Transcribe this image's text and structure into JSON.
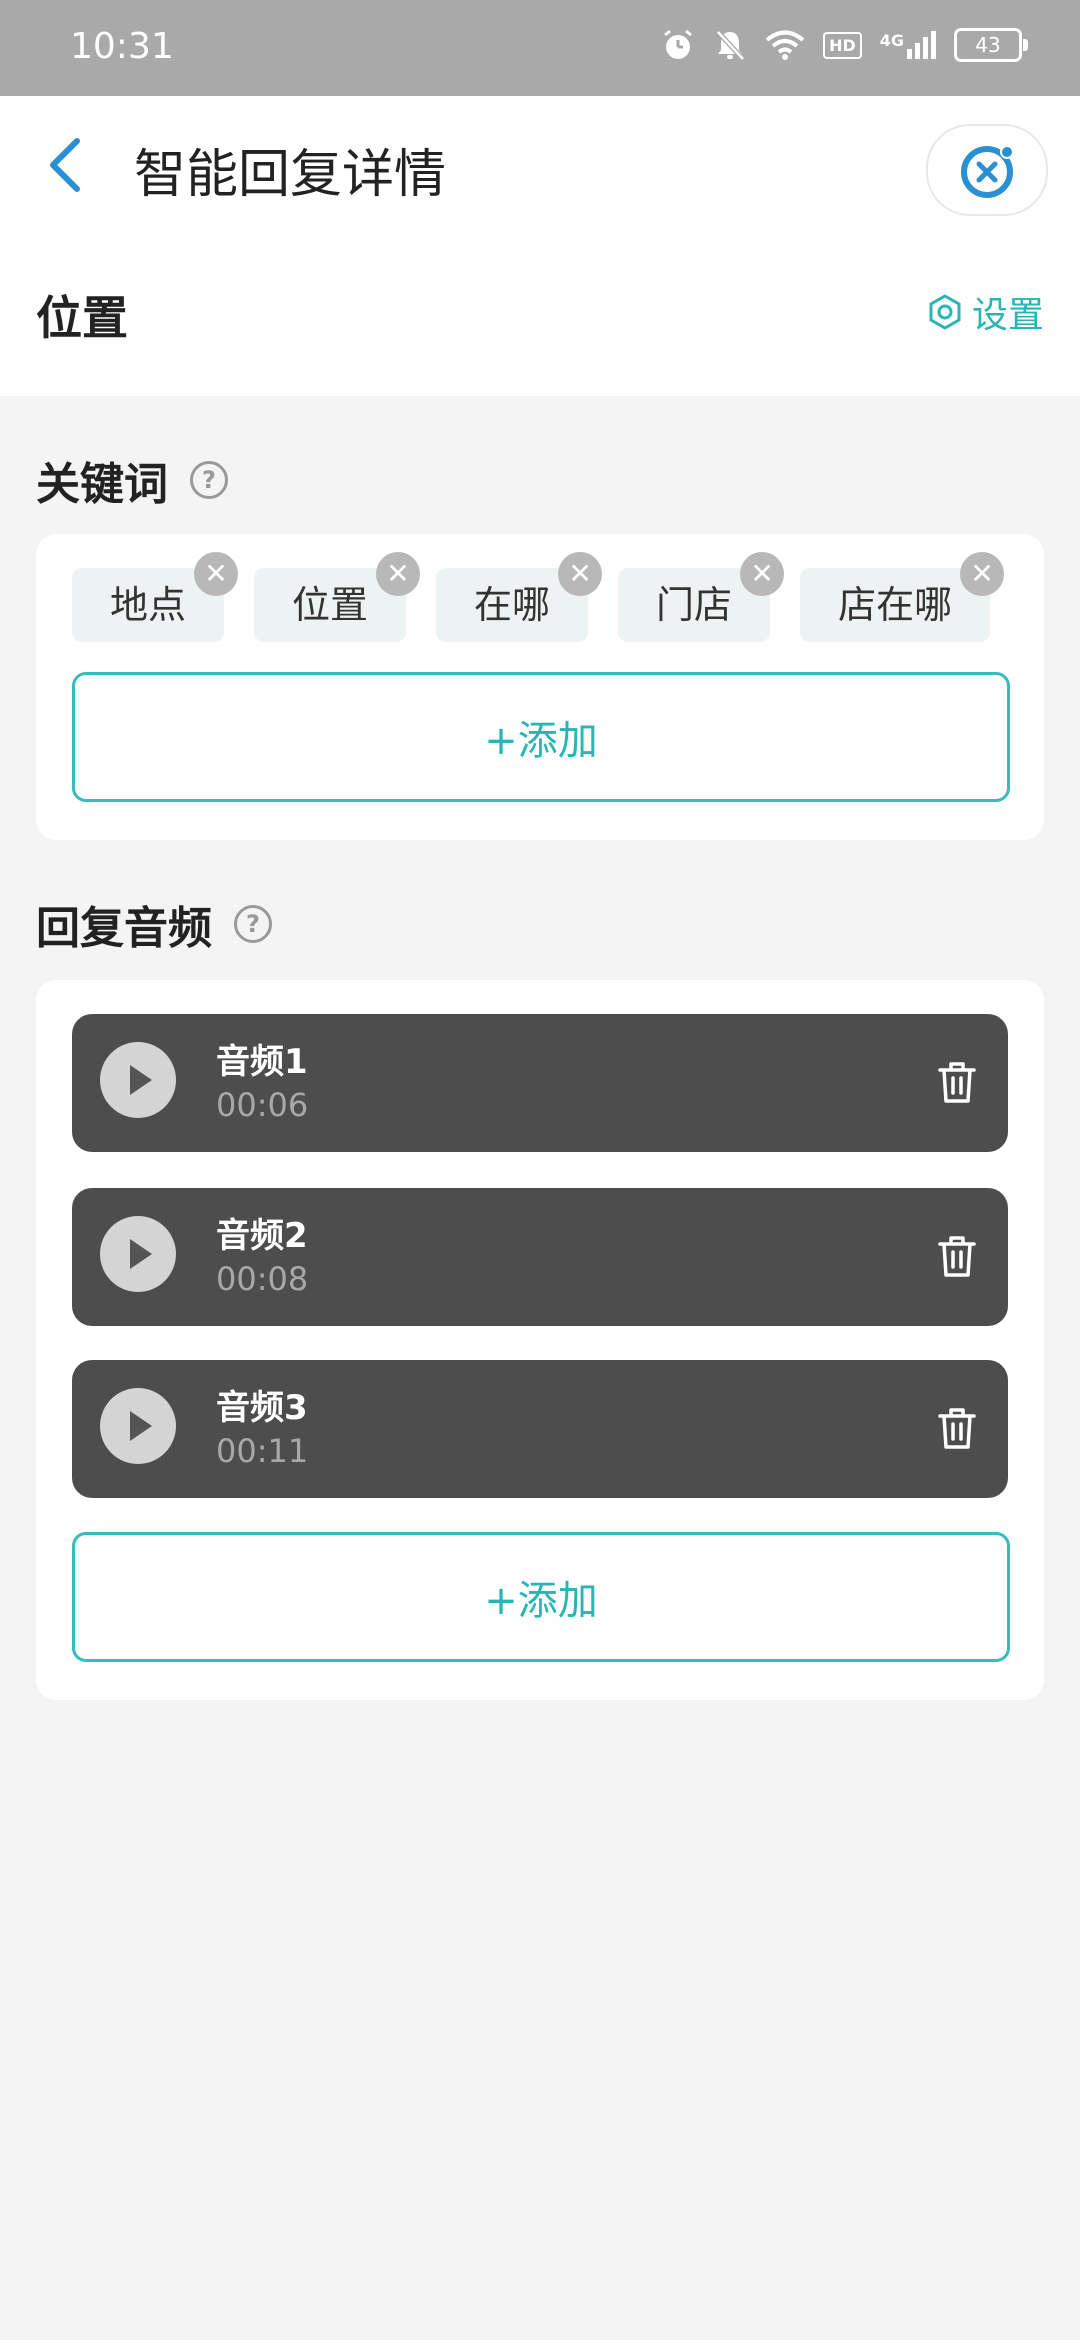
{
  "status_bar": {
    "time": "10:31",
    "icons": [
      "alarm-icon",
      "bell-off-icon",
      "wifi-icon",
      "hd-icon",
      "signal-4g-icon",
      "battery-icon"
    ],
    "hd_label": "HD",
    "network_label": "4G",
    "battery_level": "43"
  },
  "header": {
    "title": "智能回复详情",
    "section_name": "位置",
    "settings_label": "设置"
  },
  "keywords": {
    "title": "关键词",
    "help_glyph": "?",
    "remove_glyph": "✕",
    "chips": [
      "地点",
      "位置",
      "在哪",
      "门店",
      "店在哪"
    ],
    "add_label": "+添加"
  },
  "audio": {
    "title": "回复音频",
    "help_glyph": "?",
    "items": [
      {
        "name": "音频1",
        "duration": "00:06"
      },
      {
        "name": "音频2",
        "duration": "00:08"
      },
      {
        "name": "音频3",
        "duration": "00:11"
      }
    ],
    "add_label": "+添加"
  },
  "colors": {
    "accent": "#2ab5b5",
    "back_arrow": "#2b8fd4",
    "audio_item_bg": "#4d4d4d",
    "status_bar_bg": "#a9a9a9"
  }
}
